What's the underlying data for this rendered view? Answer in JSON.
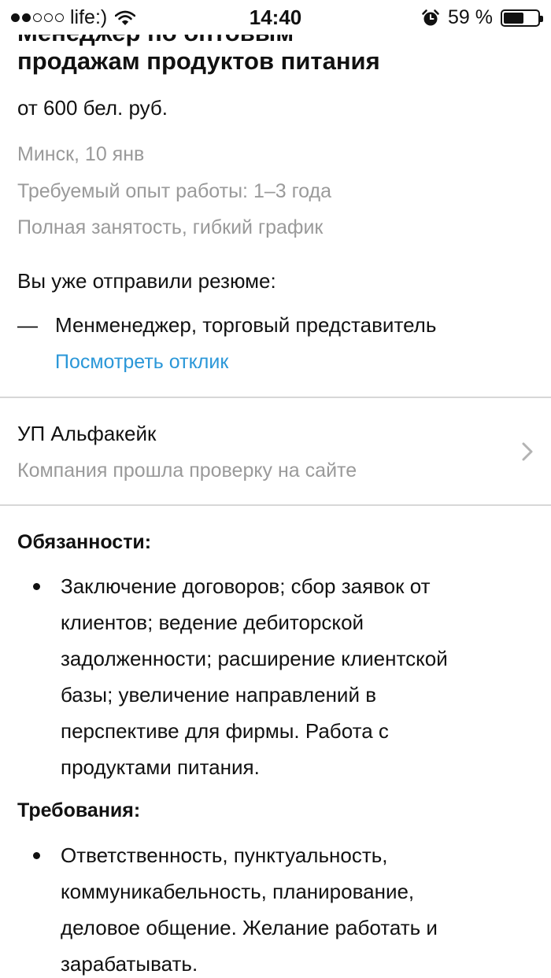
{
  "status_bar": {
    "carrier": "life:)",
    "time": "14:40",
    "battery_percent": "59 %",
    "battery_level": 0.59,
    "signal_full_dots": 2,
    "signal_total_dots": 5
  },
  "vacancy": {
    "title_cut": "Менеджер по оптовым",
    "title": "продажам продуктов питания",
    "salary": "от 600 бел. руб.",
    "location_date": "Минск, 10 янв",
    "experience": "Требуемый опыт работы: 1–3 года",
    "schedule": "Полная занятость, гибкий график"
  },
  "application": {
    "heading": "Вы уже отправили резюме:",
    "dash": "—",
    "resume_name": "Менменеджер, торговый представитель",
    "view_link": "Посмотреть отклик"
  },
  "company": {
    "name": "УП Альфакейк",
    "verified": "Компания прошла проверку на сайте"
  },
  "duties": {
    "heading": "Обязанности:",
    "lines": [
      "Заключение договоров; сбор заявок от",
      "клиентов; ведение дебиторской",
      "задолженности; расширение клиентской",
      "базы; увеличение направлений в",
      "перспективе для фирмы. Работа с",
      "продуктами питания."
    ]
  },
  "requirements": {
    "heading": "Требования:",
    "lines": [
      "Ответственность, пунктуальность,",
      "коммуникабельность, планирование,",
      "деловое общение. Желание работать и",
      "зарабатывать."
    ]
  }
}
